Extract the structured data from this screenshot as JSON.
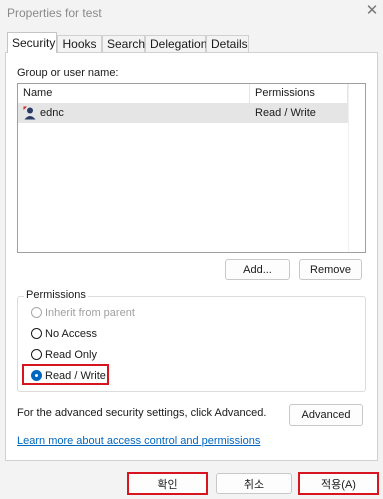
{
  "window": {
    "title": "Properties for test",
    "close_icon": "close-icon"
  },
  "tabs": [
    {
      "label": "Security",
      "active": true
    },
    {
      "label": "Hooks",
      "active": false
    },
    {
      "label": "Search",
      "active": false
    },
    {
      "label": "Delegation",
      "active": false
    },
    {
      "label": "Details",
      "active": false
    }
  ],
  "security": {
    "group_label": "Group or user name:",
    "columns": {
      "name": "Name",
      "permissions": "Permissions"
    },
    "rows": [
      {
        "name": "ednc",
        "permissions": "Read / Write",
        "icon": "user-icon",
        "selected": true
      }
    ],
    "add_button": "Add...",
    "remove_button": "Remove",
    "permissions_legend": "Permissions",
    "options": [
      {
        "label": "Inherit from parent",
        "disabled": true,
        "checked": false
      },
      {
        "label": "No Access",
        "disabled": false,
        "checked": false
      },
      {
        "label": "Read Only",
        "disabled": false,
        "checked": false
      },
      {
        "label": "Read / Write",
        "disabled": false,
        "checked": true
      }
    ],
    "advanced_text": "For the advanced security settings, click Advanced.",
    "advanced_button": "Advanced",
    "learn_more_link": "Learn more about access control and permissions"
  },
  "footer": {
    "ok": "확인",
    "cancel": "취소",
    "apply": "적용(A)"
  },
  "colors": {
    "accent": "#0067c0",
    "highlight_box": "#d8151f",
    "selection": "#e5e5e5"
  }
}
